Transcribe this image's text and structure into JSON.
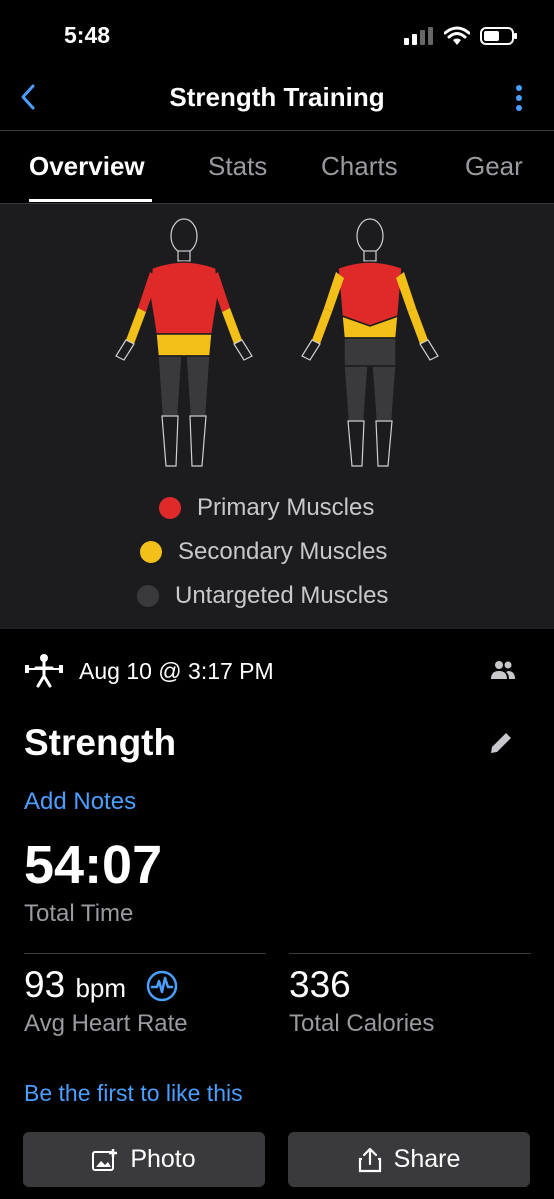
{
  "status": {
    "time": "5:48"
  },
  "nav": {
    "title": "Strength Training"
  },
  "tabs": [
    "Overview",
    "Stats",
    "Charts",
    "Gear"
  ],
  "legend": {
    "primary": "Primary Muscles",
    "secondary": "Secondary Muscles",
    "untargeted": "Untargeted Muscles"
  },
  "colors": {
    "primary": "#e02a2a",
    "secondary": "#f3c01a",
    "untargeted": "#3a3a3c",
    "link": "#4a9fff"
  },
  "activity": {
    "date": "Aug 10 @ 3:17 PM",
    "title": "Strength",
    "add_notes": "Add Notes",
    "total_time": "54:07",
    "total_time_label": "Total Time",
    "heart_rate": "93",
    "heart_rate_unit": "bpm",
    "heart_rate_label": "Avg Heart Rate",
    "calories": "336",
    "calories_label": "Total Calories",
    "like_text": "Be the first to like this"
  },
  "actions": {
    "photo": "Photo",
    "share": "Share"
  }
}
